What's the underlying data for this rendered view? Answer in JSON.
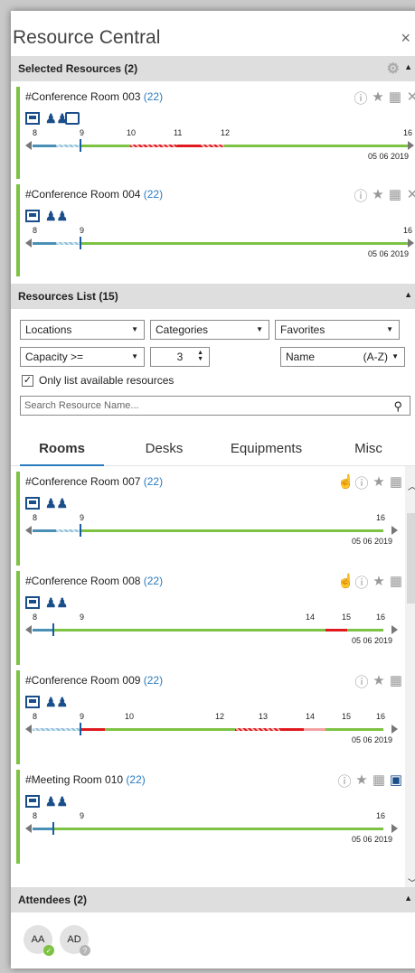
{
  "app": {
    "title": "Resource Central",
    "close_icon": "×"
  },
  "selected": {
    "header": "Selected Resources (2)",
    "items": [
      {
        "name": "#Conference Room 003",
        "count": "(22)",
        "date": "05 06 2019",
        "hours": [
          "8",
          "9",
          "10",
          "11",
          "12",
          "16"
        ]
      },
      {
        "name": "#Conference Room 004",
        "count": "(22)",
        "date": "05 06 2019",
        "hours": [
          "8",
          "9",
          "16"
        ]
      }
    ]
  },
  "resources_list": {
    "header": "Resources List (15)",
    "filters": {
      "locations": "Locations",
      "categories": "Categories",
      "favorites": "Favorites",
      "capacity": "Capacity >=",
      "capacity_value": "3",
      "sort_name": "Name",
      "sort_order": "(A-Z)"
    },
    "only_available": "Only list available resources",
    "search_placeholder": "Search Resource Name...",
    "tabs": [
      "Rooms",
      "Desks",
      "Equipments",
      "Misc"
    ]
  },
  "rooms": [
    {
      "name": "#Conference Room 007",
      "count": "(22)",
      "date": "05 06 2019",
      "hours": [
        "8",
        "9",
        "16"
      ]
    },
    {
      "name": "#Conference Room 008",
      "count": "(22)",
      "date": "05 06 2019",
      "hours": [
        "8",
        "9",
        "14",
        "15",
        "16"
      ]
    },
    {
      "name": "#Conference Room 009",
      "count": "(22)",
      "date": "05 06 2019",
      "hours": [
        "8",
        "9",
        "10",
        "12",
        "13",
        "14",
        "15",
        "16"
      ]
    },
    {
      "name": "#Meeting Room 010",
      "count": "(22)",
      "date": "05 06 2019",
      "hours": [
        "8",
        "9",
        "16"
      ]
    }
  ],
  "attendees": {
    "header": "Attendees (2)",
    "people": [
      {
        "initials": "AA",
        "status": "accepted"
      },
      {
        "initials": "AD",
        "status": "unknown"
      }
    ]
  },
  "colors": {
    "free": "#7dc242",
    "busy": "#e0191e",
    "accent": "#2a7bc0",
    "now": "#1a5aa0"
  }
}
